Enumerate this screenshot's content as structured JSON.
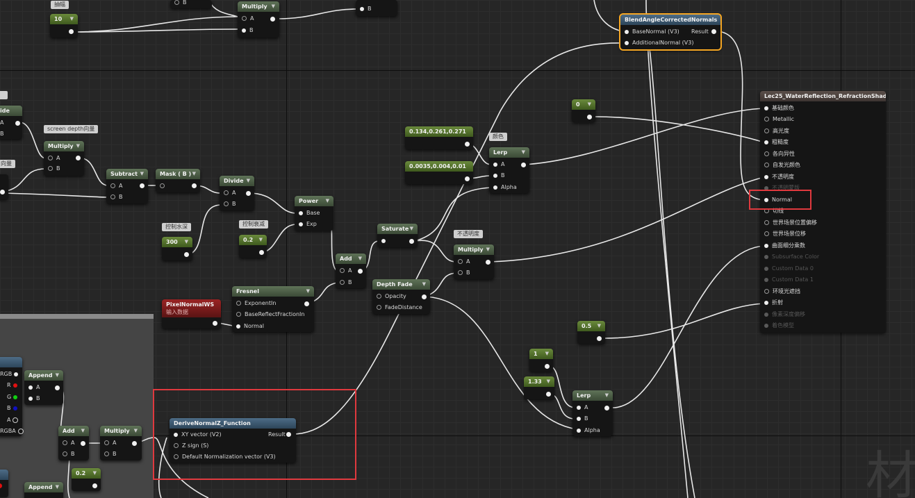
{
  "nodes": {
    "n_switch": {
      "label": "抽幅"
    },
    "n_10": {
      "value": "10"
    },
    "n_b_top": {
      "pin": "B"
    },
    "n_mult_top": {
      "title": "Multiply",
      "a": "A",
      "b": "B"
    },
    "n_b_top2": {
      "pin": "B"
    },
    "bacn": {
      "title": "BlendAngleCorrectedNormals",
      "base": "BaseNormal (V3)",
      "add": "AdditionalNormal (V3)",
      "result": "Result"
    },
    "lec": {
      "title": "Lec25_WaterReflection_RefractionShader",
      "pins": [
        "基础颜色",
        "Metallic",
        "高光度",
        "粗糙度",
        "各向异性",
        "自发光颜色",
        "不透明度",
        "不透明蒙版",
        "Normal",
        "切线",
        "世界场景位置偏移",
        "世界场景位移",
        "曲面细分乘数",
        "Subsurface Color",
        "Custom Data 0",
        "Custom Data 1",
        "环境光遮挡",
        "折射",
        "像素深度偏移",
        "着色模型"
      ]
    },
    "n_0": {
      "value": "0"
    },
    "n_ide": {
      "title": "ide",
      "a": "A",
      "b": "B"
    },
    "c_screen": {
      "text": "screen depth向量"
    },
    "n_mult2": {
      "title": "Multiply",
      "a": "A",
      "b": "B"
    },
    "c_vec": {
      "text": "向量"
    },
    "n_sub": {
      "title": "Subtract",
      "a": "A",
      "b": "B"
    },
    "n_mask": {
      "title": "Mask ( B )"
    },
    "n_div": {
      "title": "Divide",
      "a": "A",
      "b": "B"
    },
    "n_col1": {
      "value": "0.134,0.261,0.271"
    },
    "n_col2": {
      "value": "0.0035,0.004,0.01"
    },
    "c_color": {
      "text": "颜色"
    },
    "n_lerp1": {
      "title": "Lerp",
      "a": "A",
      "b": "B",
      "alpha": "Alpha"
    },
    "c_ctrl1": {
      "text": "控制水深"
    },
    "n_300": {
      "value": "300"
    },
    "c_ctrl2": {
      "text": "控制衰减"
    },
    "n_02": {
      "value": "0.2"
    },
    "n_pow": {
      "title": "Power",
      "base": "Base",
      "exp": "Exp"
    },
    "n_sat": {
      "title": "Saturate"
    },
    "c_opac": {
      "text": "不透明度"
    },
    "n_mult3": {
      "title": "Multiply",
      "a": "A",
      "b": "B"
    },
    "n_add1": {
      "title": "Add",
      "a": "A",
      "b": "B"
    },
    "n_depth": {
      "title": "Depth Fade",
      "opacity": "Opacity",
      "fade": "FadeDistance"
    },
    "n_pnws": {
      "title": "PixelNormalWS",
      "sub": "输入数据"
    },
    "n_fres": {
      "title": "Fresnel",
      "exp": "ExponentIn",
      "base": "BaseReflectFractionIn",
      "normal": "Normal"
    },
    "n_05": {
      "value": "0.5"
    },
    "n_1": {
      "value": "1"
    },
    "n_133": {
      "value": "1.33"
    },
    "n_lerp2": {
      "title": "Lerp",
      "a": "A",
      "b": "B",
      "alpha": "Alpha"
    },
    "n_tex": {
      "pins": [
        "RGB",
        "R",
        "G",
        "B",
        "A",
        "RGBA"
      ]
    },
    "n_app1": {
      "title": "Append",
      "a": "A",
      "b": "B"
    },
    "n_add2": {
      "title": "Add",
      "a": "A",
      "b": "B"
    },
    "n_mult4": {
      "title": "Multiply",
      "a": "A",
      "b": "B"
    },
    "n_02b": {
      "value": "0.2"
    },
    "n_app2": {
      "title": "Append"
    },
    "dnz": {
      "title": "DeriveNormalZ_Function",
      "xy": "XY vector (V2)",
      "z": "Z sign (S)",
      "def": "Default Normalization vector (V3)",
      "result": "Result"
    }
  },
  "watermark": "材"
}
